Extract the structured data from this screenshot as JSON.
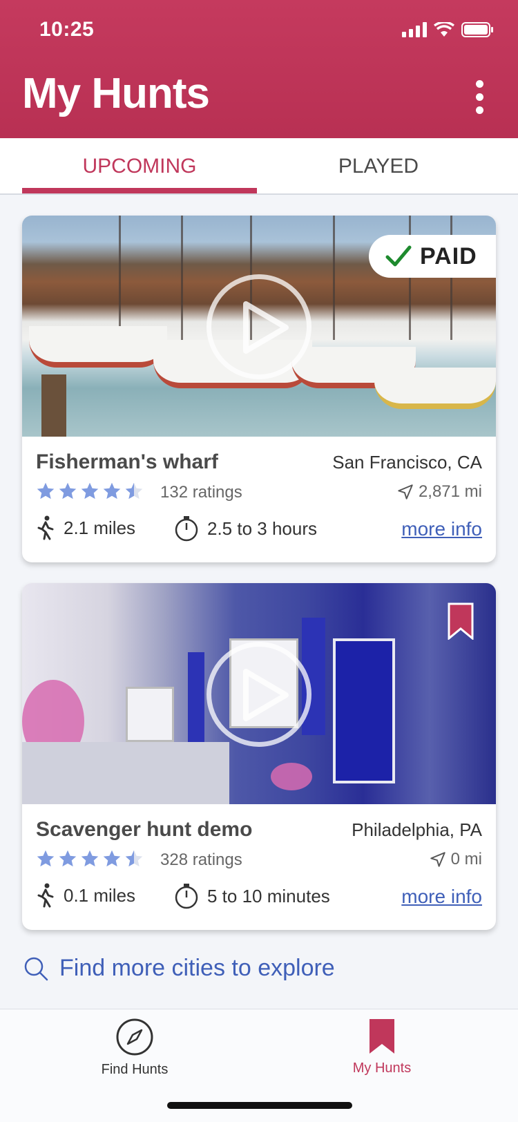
{
  "status_bar": {
    "time": "10:25"
  },
  "header": {
    "title": "My Hunts"
  },
  "tabs": [
    {
      "label": "UPCOMING",
      "active": true
    },
    {
      "label": "PLAYED",
      "active": false
    }
  ],
  "hunts": [
    {
      "title": "Fisherman's wharf",
      "city": "San Francisco, CA",
      "rating": 4.5,
      "ratings_text": "132 ratings",
      "distance": "2,871 mi",
      "length": "2.1 miles",
      "duration": "2.5 to 3 hours",
      "more_info": "more info",
      "badge": "PAID"
    },
    {
      "title": "Scavenger hunt demo",
      "city": "Philadelphia, PA",
      "rating": 4.5,
      "ratings_text": "328 ratings",
      "distance": "0 mi",
      "length": "0.1 miles",
      "duration": "5 to 10 minutes",
      "more_info": "more info",
      "bookmarked": true
    }
  ],
  "find_more": {
    "label": "Find more cities to explore"
  },
  "bottom_nav": [
    {
      "label": "Find Hunts",
      "icon": "compass-icon",
      "active": false
    },
    {
      "label": "My Hunts",
      "icon": "bookmark-icon",
      "active": true
    }
  ],
  "colors": {
    "brand": "#c0375b",
    "link": "#3f5fb8",
    "star": "#7f9be0"
  }
}
